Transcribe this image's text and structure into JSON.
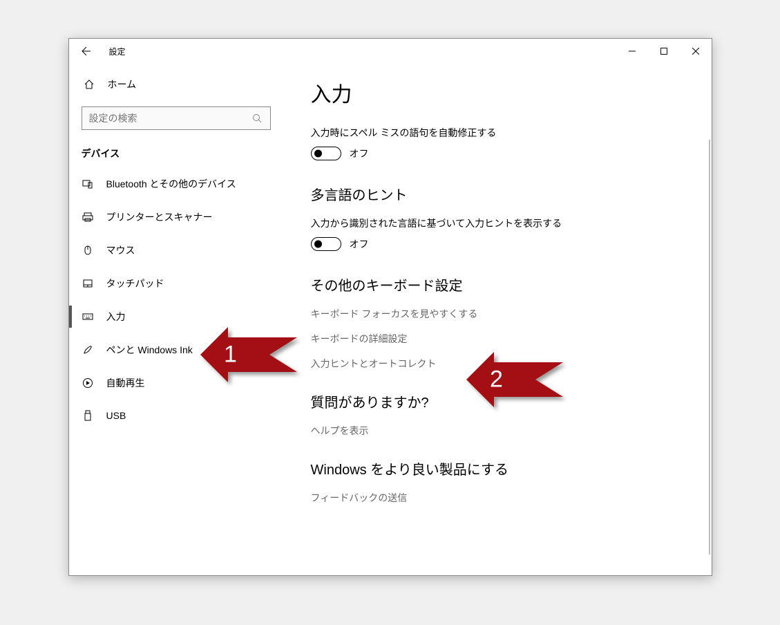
{
  "window": {
    "title": "設定"
  },
  "sidebar": {
    "home": "ホーム",
    "search_placeholder": "設定の検索",
    "category": "デバイス",
    "items": [
      {
        "label": "Bluetooth とその他のデバイス"
      },
      {
        "label": "プリンターとスキャナー"
      },
      {
        "label": "マウス"
      },
      {
        "label": "タッチパッド"
      },
      {
        "label": "入力",
        "selected": true
      },
      {
        "label": "ペンと Windows Ink"
      },
      {
        "label": "自動再生"
      },
      {
        "label": "USB"
      }
    ]
  },
  "main": {
    "title": "入力",
    "autocorrect": {
      "label": "入力時にスペル ミスの語句を自動修正する",
      "state": "オフ"
    },
    "multilang": {
      "title": "多言語のヒント",
      "label": "入力から識別された言語に基づいて入力ヒントを表示する",
      "state": "オフ"
    },
    "other": {
      "title": "その他のキーボード設定",
      "links": [
        "キーボード フォーカスを見やすくする",
        "キーボードの詳細設定",
        "入力ヒントとオートコレクト"
      ]
    },
    "help": {
      "title": "質問がありますか?",
      "link": "ヘルプを表示"
    },
    "feedback": {
      "title": "Windows をより良い製品にする",
      "link": "フィードバックの送信"
    }
  },
  "annotations": {
    "arrow1": "1",
    "arrow2": "2"
  }
}
